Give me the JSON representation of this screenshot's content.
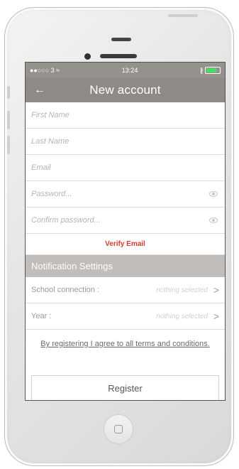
{
  "status": {
    "carrier": "●●○○○ 3 ≈",
    "time": "13:24",
    "bt": "∦"
  },
  "nav": {
    "back": "←",
    "title": "New account"
  },
  "form": {
    "first_name": "First Name",
    "last_name": "Last Name",
    "email": "Email",
    "password": "Password...",
    "confirm_password": "Confirm password...",
    "verify": "Verify Email"
  },
  "notifications": {
    "header": "Notification Settings",
    "school_label": "School connection :",
    "school_value": "nothing selected",
    "year_label": "Year :",
    "year_value": "nothing selected",
    "chevron": ">"
  },
  "terms": "By registering I agree to all terms and conditions.",
  "register_label": "Register"
}
